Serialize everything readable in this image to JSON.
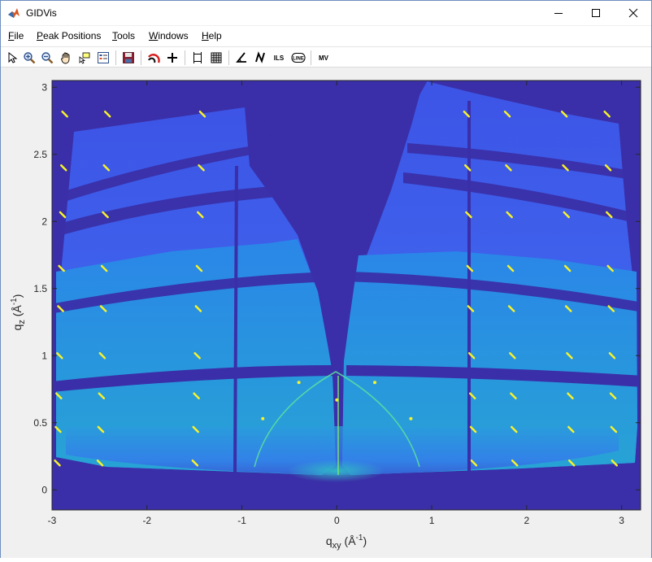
{
  "window": {
    "title": "GIDVis",
    "controls": {
      "minimize": "minimize-icon",
      "maximize": "maximize-icon",
      "close": "close-icon"
    }
  },
  "menubar": {
    "items": [
      {
        "label": "File",
        "u": "F",
        "rest": "ile"
      },
      {
        "label": "Peak Positions",
        "u": "P",
        "rest": "eak Positions"
      },
      {
        "label": "Tools",
        "u": "T",
        "rest": "ools"
      },
      {
        "label": "Windows",
        "u": "W",
        "rest": "indows"
      },
      {
        "label": "Help",
        "u": "H",
        "rest": "elp"
      }
    ]
  },
  "toolbar": {
    "icons": [
      "pointer-icon",
      "zoom-in-icon",
      "zoom-out-icon",
      "pan-hand-icon",
      "data-cursor-icon",
      "legend-icon",
      "save-icon",
      "beamline-arc-icon",
      "crosshair-icon",
      "rectangle-select-icon",
      "grid-icon",
      "angle-icon",
      "n-icon",
      "ils-icon",
      "line-icon",
      "mv-icon"
    ],
    "ils_label": "ILS",
    "line_label": "LINE",
    "mv_label": "MV"
  },
  "chart_data": {
    "type": "heatmap",
    "title": "",
    "xlabel_base": "q",
    "xlabel_sub": "xy",
    "xlabel_unit_open": " (Å",
    "xlabel_unit_sup": "-1",
    "xlabel_unit_close": ")",
    "ylabel_base": "q",
    "ylabel_sub": "z",
    "ylabel_unit_open": " (Å",
    "ylabel_unit_sup": "-1",
    "ylabel_unit_close": ")",
    "xlim": [
      -3,
      3.2
    ],
    "ylim": [
      -0.15,
      3.05
    ],
    "xticks": [
      {
        "v": -3,
        "label": "-3"
      },
      {
        "v": -2,
        "label": "-2"
      },
      {
        "v": -1,
        "label": "-1"
      },
      {
        "v": 0,
        "label": "0"
      },
      {
        "v": 1,
        "label": "1"
      },
      {
        "v": 2,
        "label": "2"
      },
      {
        "v": 3,
        "label": "3"
      }
    ],
    "yticks": [
      {
        "v": 0,
        "label": "0"
      },
      {
        "v": 0.5,
        "label": "0.5"
      },
      {
        "v": 1,
        "label": "1"
      },
      {
        "v": 1.5,
        "label": "1.5"
      },
      {
        "v": 2,
        "label": "2"
      },
      {
        "v": 2.5,
        "label": "2.5"
      },
      {
        "v": 3,
        "label": "3"
      }
    ],
    "colors": {
      "background": "#3a2fa8",
      "low": "#3d62f0",
      "mid": "#2bb9c9",
      "high": "#f7f22a"
    },
    "peak_columns_qxy": [
      -2.95,
      -2.5,
      -1.5,
      1.45,
      1.88,
      2.48,
      2.93
    ]
  }
}
